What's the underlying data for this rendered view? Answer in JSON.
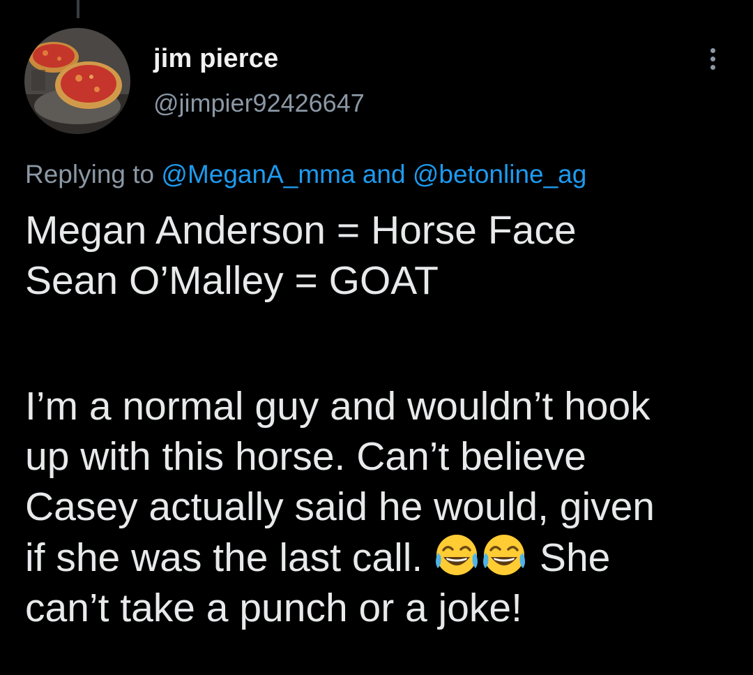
{
  "tweet": {
    "author": {
      "display_name": "jim pierce",
      "handle": "@jimpier92426647",
      "avatar": "pizza-photo-avatar"
    },
    "reply_context": {
      "prefix": "Replying to ",
      "mention_1": "@MeganA_mma",
      "connector": " and ",
      "mention_2": "@betonline_ag"
    },
    "body": {
      "line1": "Megan Anderson = Horse Face",
      "line2": "Sean O’Malley = GOAT",
      "line3": "I’m a normal guy and wouldn’t hook",
      "line4": "up with this horse. Can’t believe",
      "line5": "Casey actually said he would, given",
      "line6_text": "if she was the last call. ",
      "line6_emojis": [
        "face-with-tears-of-joy-emoji",
        "face-with-tears-of-joy-emoji"
      ],
      "line6_tail": " She",
      "line7": "can’t take a punch or a joke!"
    },
    "more_icon": "more-vertical-icon"
  },
  "colors": {
    "background": "#000000",
    "text_primary": "#e7e9ea",
    "text_secondary": "#8b98a5",
    "link": "#1d9bf0"
  }
}
